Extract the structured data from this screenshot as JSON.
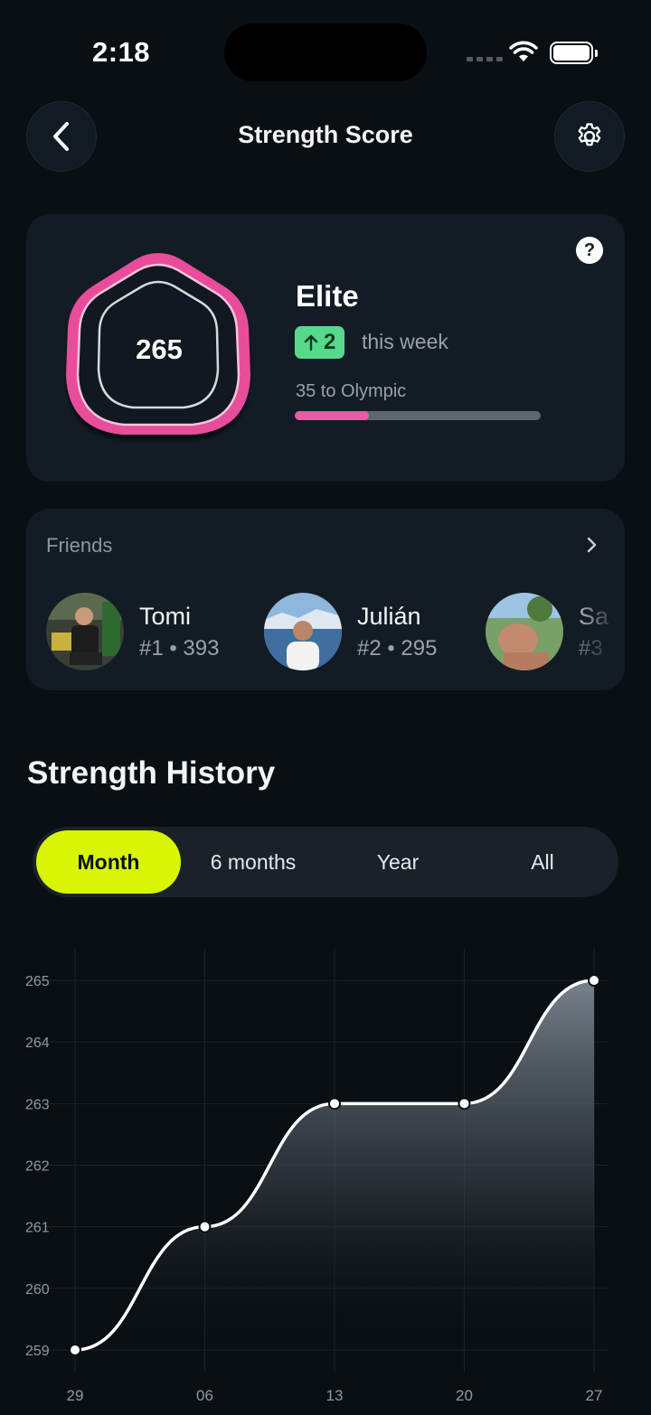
{
  "status_bar": {
    "time": "2:18"
  },
  "header": {
    "title": "Strength Score"
  },
  "score_card": {
    "score": "265",
    "tier": "Elite",
    "weekly_change": "2",
    "weekly_change_label": "this week",
    "next_tier_label": "35 to Olympic",
    "progress_to_next_tier": 0.3,
    "help_label": "?"
  },
  "friends": {
    "title": "Friends",
    "items": [
      {
        "name": "Tomi",
        "rank": "#1 • 393"
      },
      {
        "name": "Julián",
        "rank": "#2 • 295"
      },
      {
        "name": "Sa",
        "rank": "#3"
      }
    ]
  },
  "history": {
    "title": "Strength History",
    "tabs": [
      {
        "label": "Month",
        "active": true
      },
      {
        "label": "6 months",
        "active": false
      },
      {
        "label": "Year",
        "active": false
      },
      {
        "label": "All",
        "active": false
      }
    ]
  },
  "colors": {
    "accent": "#d8f505",
    "badge": "#e84d9b",
    "positive": "#57d98c"
  },
  "chart_data": {
    "type": "area",
    "categories": [
      "29",
      "06",
      "13",
      "20",
      "27"
    ],
    "values": [
      259,
      261,
      263,
      263,
      265
    ],
    "yticks": [
      265,
      264,
      263,
      262,
      261,
      260,
      259
    ],
    "ylim": [
      259,
      265
    ],
    "grid": true,
    "title": "",
    "xlabel": "",
    "ylabel": ""
  }
}
